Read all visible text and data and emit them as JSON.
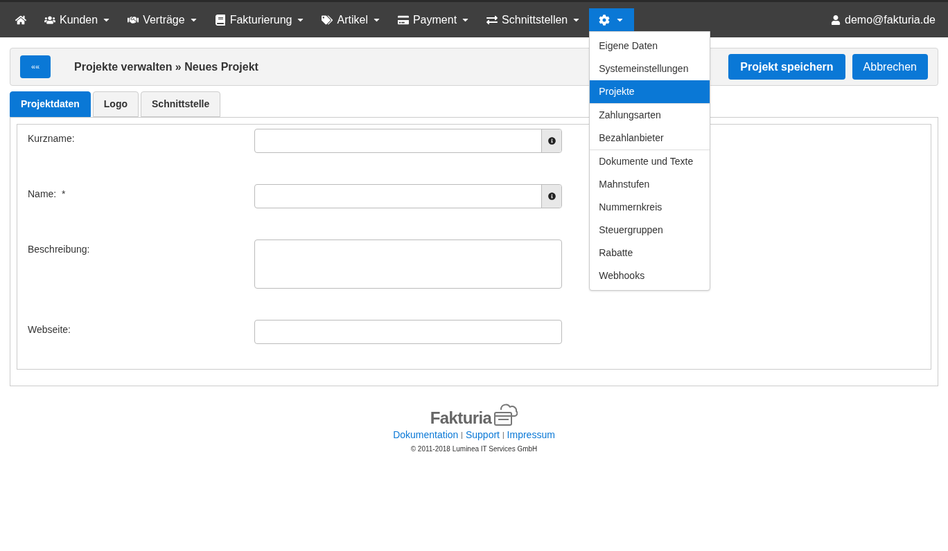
{
  "navbar": {
    "items": [
      {
        "selected": false
      },
      {
        "label": "Kunden",
        "selected": false
      },
      {
        "label": "Verträge",
        "selected": false
      },
      {
        "label": "Fakturierung",
        "selected": false
      },
      {
        "label": "Artikel",
        "selected": false
      },
      {
        "label": "Payment",
        "selected": false
      },
      {
        "label": "Schnittstellen",
        "selected": false
      },
      {
        "selected": true
      }
    ],
    "user": "demo@fakturia.de",
    "settings_menu": [
      {
        "label": "Eigene Daten",
        "selected": false,
        "divider_after": false
      },
      {
        "label": "Systemeinstellungen",
        "selected": false,
        "divider_after": false
      },
      {
        "label": "Projekte",
        "selected": true,
        "divider_after": true
      },
      {
        "label": "Zahlungsarten",
        "selected": false,
        "divider_after": false
      },
      {
        "label": "Bezahlanbieter",
        "selected": false,
        "divider_after": true
      },
      {
        "label": "Dokumente und Texte",
        "selected": false,
        "divider_after": false
      },
      {
        "label": "Mahnstufen",
        "selected": false,
        "divider_after": false
      },
      {
        "label": "Nummernkreis",
        "selected": false,
        "divider_after": false
      },
      {
        "label": "Steuergruppen",
        "selected": false,
        "divider_after": false
      },
      {
        "label": "Rabatte",
        "selected": false,
        "divider_after": false
      },
      {
        "label": "Webhooks",
        "selected": false,
        "divider_after": false
      }
    ]
  },
  "header": {
    "back_button": "««",
    "title": "Projekte verwalten » Neues Projekt",
    "save_button": "Projekt speichern",
    "cancel_button": "Abbrechen"
  },
  "tabs": [
    {
      "label": "Projektdaten",
      "selected": true
    },
    {
      "label": "Logo",
      "selected": false
    },
    {
      "label": "Schnittstelle",
      "selected": false
    }
  ],
  "form": [
    {
      "label": "Kurzname:",
      "kind": "input_info"
    },
    {
      "label": "Name:  *",
      "kind": "input_info"
    },
    {
      "label": "Beschreibung:",
      "kind": "textarea"
    },
    {
      "label": "Webseite:",
      "kind": "input"
    }
  ],
  "footer": {
    "logo": "Fakturia",
    "links": [
      "Dokumentation",
      "Support",
      "Impressum"
    ],
    "separator": "|",
    "copyright": "© 2011-2018 Luminea IT Services GmbH"
  }
}
